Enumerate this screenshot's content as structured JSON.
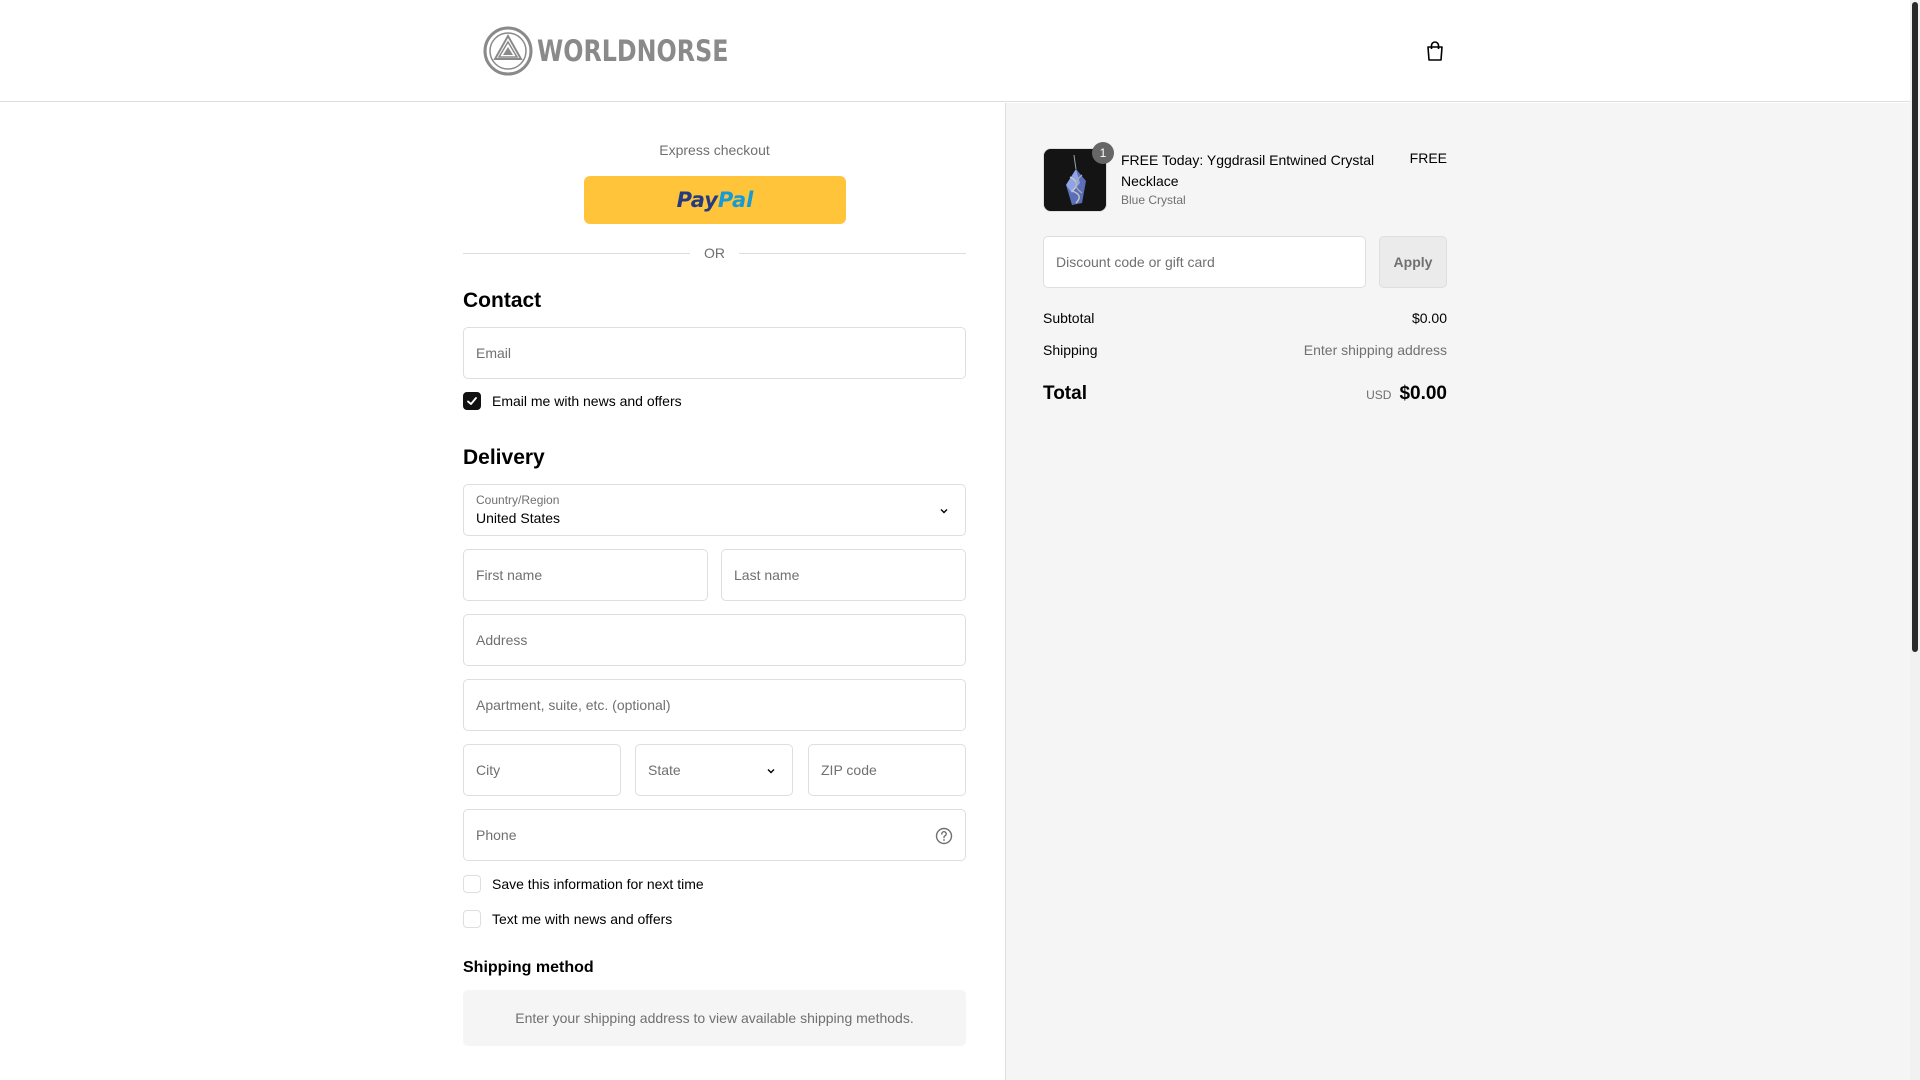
{
  "brand": {
    "name": "WORLDNORSE"
  },
  "express": {
    "label": "Express checkout",
    "paypal_part1": "Pay",
    "paypal_part2": "Pal",
    "or": "OR"
  },
  "contact": {
    "heading": "Contact",
    "email_placeholder": "Email",
    "newsletter_label": "Email me with news and offers",
    "newsletter_checked": true
  },
  "delivery": {
    "heading": "Delivery",
    "country_label": "Country/Region",
    "country_value": "United States",
    "first_name_placeholder": "First name",
    "last_name_placeholder": "Last name",
    "address_placeholder": "Address",
    "apartment_placeholder": "Apartment, suite, etc. (optional)",
    "city_placeholder": "City",
    "state_placeholder": "State",
    "zip_placeholder": "ZIP code",
    "phone_placeholder": "Phone",
    "save_info_label": "Save this information for next time",
    "save_info_checked": false,
    "sms_label": "Text me with news and offers",
    "sms_checked": false
  },
  "shipping_method": {
    "heading": "Shipping method",
    "notice": "Enter your shipping address to view available shipping methods."
  },
  "summary": {
    "item": {
      "title": "FREE Today: Yggdrasil Entwined Crystal Necklace",
      "variant": "Blue Crystal",
      "price": "FREE",
      "quantity": "1"
    },
    "discount_placeholder": "Discount code or gift card",
    "apply_label": "Apply",
    "subtotal_label": "Subtotal",
    "subtotal_value": "$0.00",
    "shipping_label": "Shipping",
    "shipping_value": "Enter shipping address",
    "total_label": "Total",
    "currency": "USD",
    "total_value": "$0.00"
  },
  "colors": {
    "paypal_yellow": "#ffc439",
    "summary_bg": "#f5f5f5",
    "border": "#dedede",
    "muted_text": "#707070"
  },
  "icons": [
    "worldnorse-logo-icon",
    "shopping-bag-icon",
    "chevron-down-icon",
    "help-circle-icon",
    "checkmark-icon"
  ]
}
